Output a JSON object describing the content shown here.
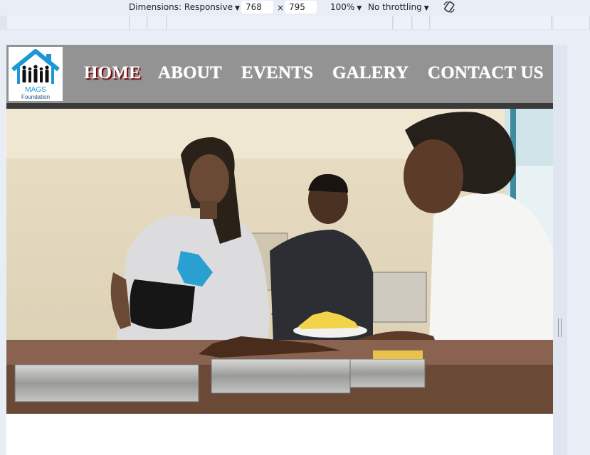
{
  "devtools": {
    "dimensions_label": "Dimensions: Responsive",
    "width": "768",
    "times": "×",
    "height": "795",
    "zoom": "100%",
    "throttling": "No throttling"
  },
  "site": {
    "logo_text_1": "MAGS",
    "logo_text_2": "Foundation",
    "nav": [
      {
        "label": "HOME",
        "active": true
      },
      {
        "label": "ABOUT",
        "active": false
      },
      {
        "label": "EVENTS",
        "active": false
      },
      {
        "label": "GALERY",
        "active": false
      },
      {
        "label": "CONTACT US",
        "active": false
      }
    ]
  },
  "colors": {
    "navbar": "#939393",
    "logo_blue": "#1d98d4",
    "active_shadow": "#7a0000"
  }
}
